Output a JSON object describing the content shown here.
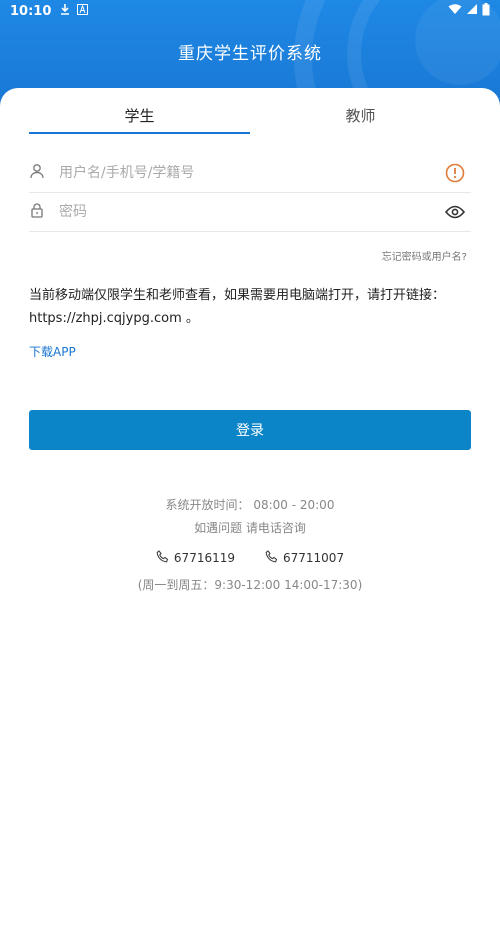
{
  "status_bar": {
    "time": "10:10"
  },
  "app": {
    "title": "重庆学生评价系统"
  },
  "tabs": [
    {
      "label": "学生",
      "active": true
    },
    {
      "label": "教师",
      "active": false
    }
  ],
  "form": {
    "username_placeholder": "用户名/手机号/学籍号",
    "password_placeholder": "密码",
    "forgot_label": "忘记密码或用户名?"
  },
  "notice": {
    "text": "当前移动端仅限学生和老师查看，如果需要用电脑端打开，请打开链接：https://zhpj.cqjypg.com 。"
  },
  "download_label": "下载APP",
  "login_label": "登录",
  "info": {
    "open_time": "系统开放时间：   08:00 - 20:00",
    "contact": "如遇问题 请电话咨询",
    "phones": [
      "67716119",
      "67711007"
    ],
    "hours": "(周一到周五：9:30-12:00 14:00-17:30)"
  },
  "colors": {
    "primary": "#1976d2",
    "button": "#0b85c8",
    "warning": "#e07b39"
  },
  "icons": [
    "download-icon",
    "a-icon",
    "wifi-icon",
    "signal-icon",
    "battery-icon",
    "user-icon",
    "warning-icon",
    "lock-icon",
    "eye-icon",
    "phone-icon"
  ]
}
